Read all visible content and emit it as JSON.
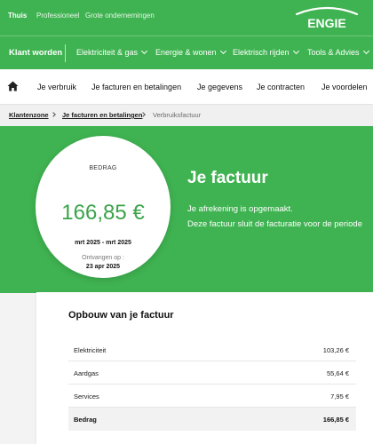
{
  "topbar": {
    "segments": [
      "Thuis",
      "Professioneel",
      "Grote ondernemingen"
    ],
    "logo_text": "ENGIE"
  },
  "mainnav": {
    "klant_worden": "Klant worden",
    "items": [
      "Elektriciteit & gas",
      "Energie & wonen",
      "Elektrisch rijden",
      "Tools & Advies"
    ]
  },
  "subnav": {
    "items": [
      "Je verbruik",
      "Je facturen en betalingen",
      "Je gegevens",
      "Je contracten",
      "Je voordelen"
    ]
  },
  "breadcrumb": {
    "items": [
      "Klantenzone",
      "Je facturen en betalingen",
      "Verbruiksfactuur"
    ]
  },
  "invoice": {
    "bedrag_label": "BEDRAG",
    "amount": "166,85 €",
    "period": "mrt 2025 - mrt 2025",
    "received_label": "Ontvangen op :",
    "received_date": "23 apr 2025"
  },
  "hero": {
    "title": "Je factuur",
    "line1": "Je afrekening is opgemaakt.",
    "line2": "Deze factuur sluit de facturatie voor de periode"
  },
  "breakdown": {
    "title": "Opbouw van je factuur",
    "rows": [
      {
        "label": "Elektriciteit",
        "value": "103,26 €"
      },
      {
        "label": "Aardgas",
        "value": "55,64 €"
      },
      {
        "label": "Services",
        "value": "7,95 €"
      },
      {
        "label": "Bedrag",
        "value": "166,85 €"
      }
    ]
  },
  "colors": {
    "brand_green": "#3fb351",
    "amount_green": "#3aa34a"
  },
  "icons": [
    "home-icon",
    "chevron-down-icon",
    "chevron-right-icon"
  ]
}
